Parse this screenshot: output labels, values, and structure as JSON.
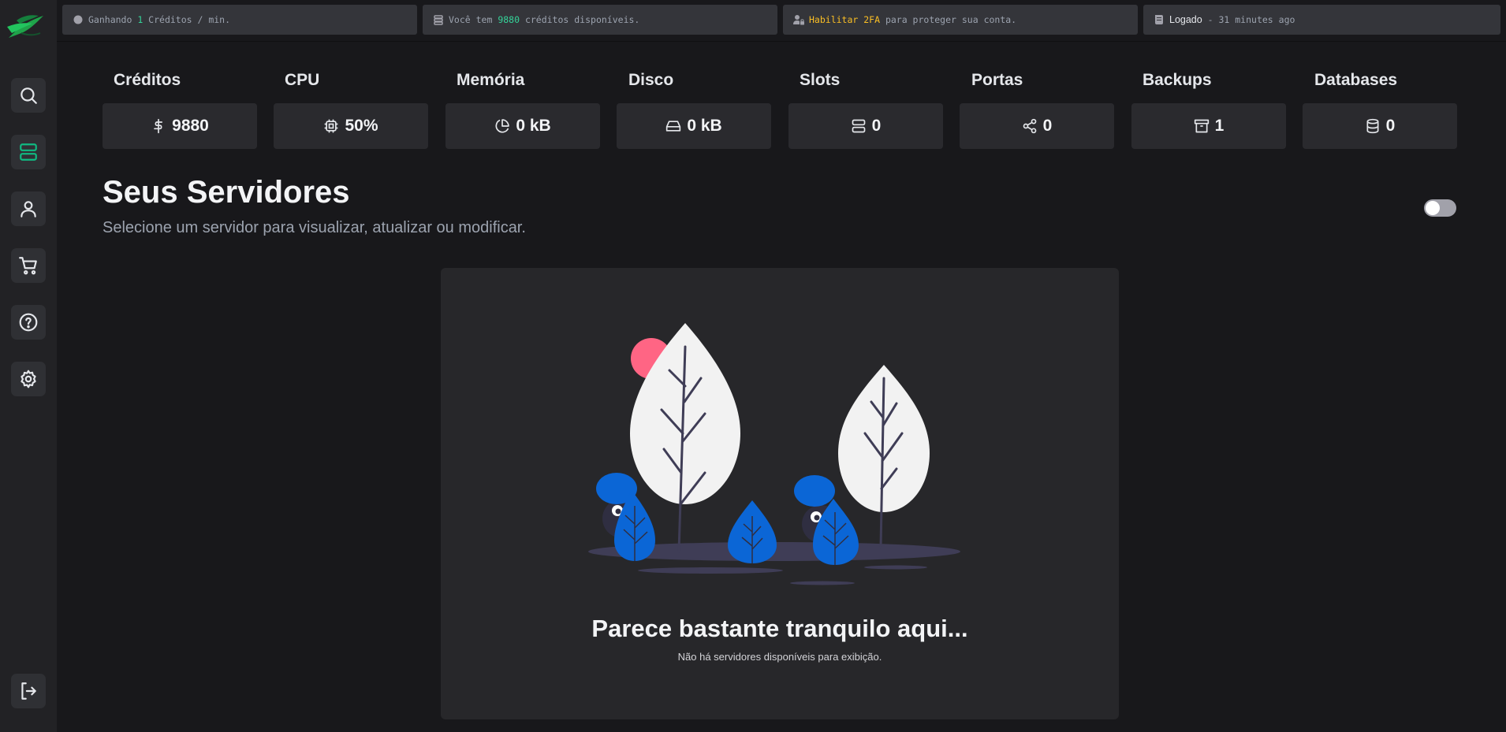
{
  "topbar": {
    "earning": {
      "prefix": "Ganhando ",
      "value": "1",
      "suffix": " Créditos / min."
    },
    "balance": {
      "prefix": "Você tem ",
      "value": "9880",
      "suffix": " créditos disponíveis."
    },
    "twofa": {
      "highlight": "Habilitar 2FA",
      "suffix": " para proteger sua conta."
    },
    "login": {
      "label": "Logado",
      "suffix": " - 31 minutes ago"
    }
  },
  "sidebar": {
    "items": [
      {
        "name": "search",
        "icon": "search-icon"
      },
      {
        "name": "servers",
        "icon": "server-icon",
        "active": true
      },
      {
        "name": "account",
        "icon": "user-icon"
      },
      {
        "name": "store",
        "icon": "cart-icon"
      },
      {
        "name": "help",
        "icon": "help-icon"
      },
      {
        "name": "settings",
        "icon": "gear-icon"
      }
    ],
    "logout_icon": "logout-icon"
  },
  "stats": [
    {
      "label": "Créditos",
      "value": "9880",
      "icon": "dollar-icon"
    },
    {
      "label": "CPU",
      "value": "50%",
      "icon": "cpu-icon"
    },
    {
      "label": "Memória",
      "value": "0 kB",
      "icon": "pie-icon"
    },
    {
      "label": "Disco",
      "value": "0 kB",
      "icon": "harddrive-icon"
    },
    {
      "label": "Slots",
      "value": "0",
      "icon": "server-icon"
    },
    {
      "label": "Portas",
      "value": "0",
      "icon": "share-icon"
    },
    {
      "label": "Backups",
      "value": "1",
      "icon": "archive-icon"
    },
    {
      "label": "Databases",
      "value": "0",
      "icon": "database-icon"
    }
  ],
  "header": {
    "title": "Seus Servidores",
    "subtitle": "Selecione um servidor para visualizar, atualizar ou modificar."
  },
  "empty_state": {
    "title": "Parece bastante tranquilo aqui...",
    "description": "Não há servidores disponíveis para exibição."
  },
  "colors": {
    "accent": "#10b981",
    "highlight": "#fbbf24",
    "leaf_blue": "#0b66d6",
    "sun_pink": "#ff6584"
  }
}
